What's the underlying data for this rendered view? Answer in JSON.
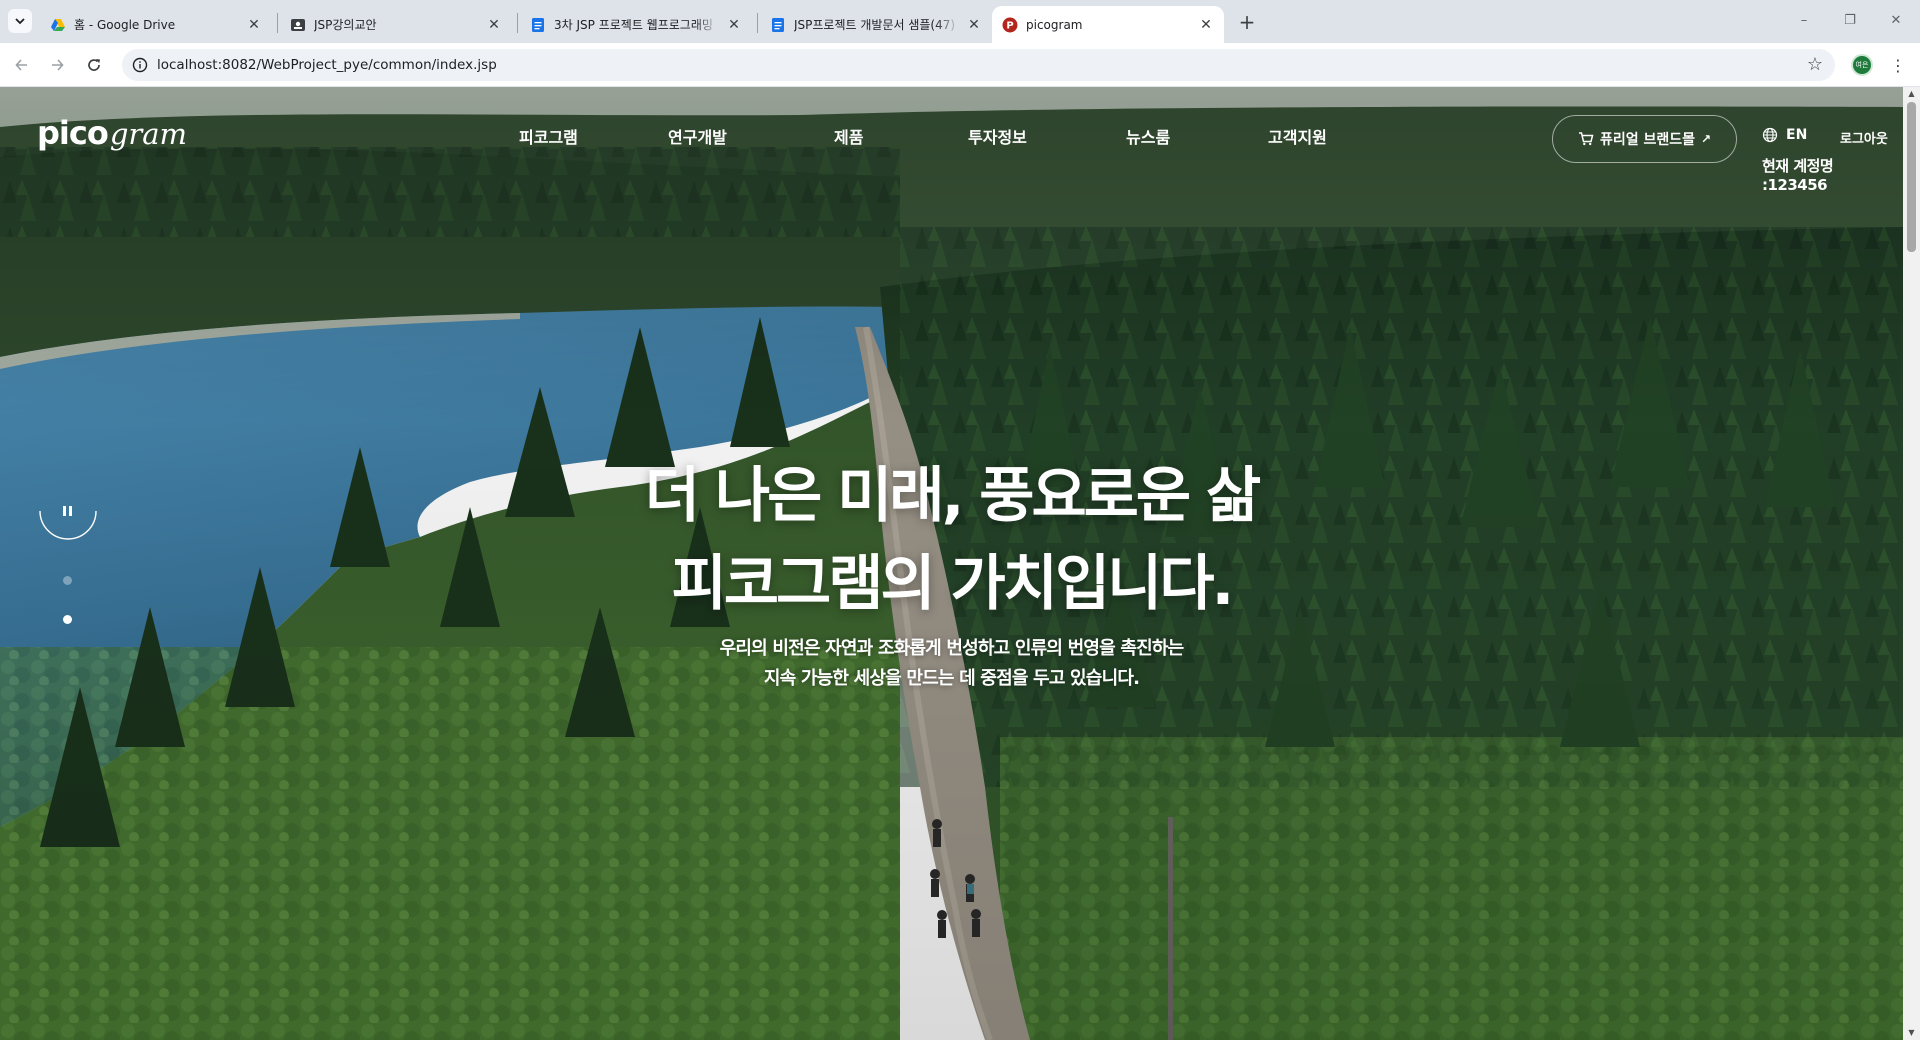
{
  "browser": {
    "tabs": [
      {
        "title": "홈 - Google Drive",
        "favicon": "google-drive-icon"
      },
      {
        "title": "JSP강의교안",
        "favicon": "slides-icon"
      },
      {
        "title": "3차 JSP 프로젝트 웹프로그래밍",
        "favicon": "docs-icon"
      },
      {
        "title": "JSP프로젝트 개발문서 샘플(47)",
        "favicon": "docs-icon"
      },
      {
        "title": "picogram",
        "favicon": "picogram-icon"
      }
    ],
    "active_tab": 4,
    "new_tab_label": "+",
    "address": "localhost:8082/WebProject_pye/common/index.jsp",
    "profile_initials": "여은",
    "window_controls": {
      "minimize": "–",
      "restore": "❐",
      "close": "✕"
    }
  },
  "site": {
    "logo": {
      "bold": "pico",
      "italic": "gram"
    },
    "nav": [
      "피코그램",
      "연구개발",
      "제품",
      "투자정보",
      "뉴스룸",
      "고객지원"
    ],
    "brand_mall": {
      "label": "퓨리얼 브랜드몰",
      "arrow": "↗"
    },
    "lang": "EN",
    "logout": "로그아웃",
    "account": "현재 계정명 :123456"
  },
  "hero": {
    "headline_line1": "더 나은 미래, 풍요로운 삶",
    "headline_line2": "피코그램의 가치입니다.",
    "sub_line1": "우리의 비전은 자연과 조화롭게 번성하고 인류의 번영을 촉진하는",
    "sub_line2": "지속 가능한 세상을 만드는 데 중점을 두고 있습니다.",
    "pause_icon": "pause-icon",
    "slides_total": 3,
    "active_slide": 2
  },
  "colors": {
    "tabstrip": "#dee3ea",
    "accent_green": "#1e7b3c",
    "lake": "#3f7fa8",
    "forest_dark": "#1f3a22",
    "forest_light": "#5a8a3a"
  }
}
